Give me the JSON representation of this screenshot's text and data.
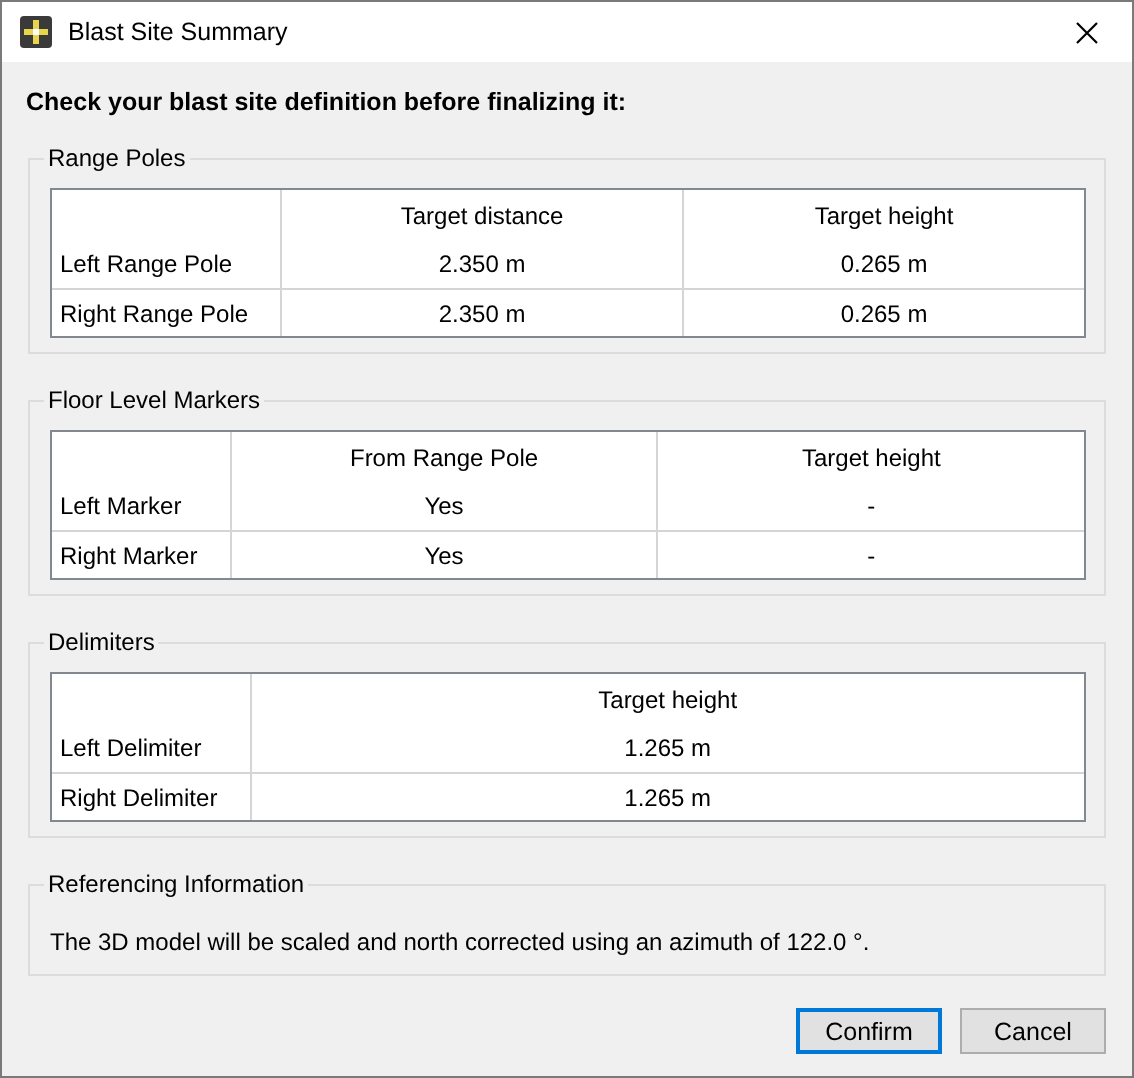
{
  "window": {
    "title": "Blast Site Summary"
  },
  "instruction": "Check your blast site definition before finalizing it:",
  "groups": [
    {
      "title": "Range Poles",
      "kind": "table",
      "columns": [
        "Target distance",
        "Target height"
      ],
      "rows": [
        {
          "label": "Left Range Pole",
          "cells": [
            "2.350 m",
            "0.265 m"
          ]
        },
        {
          "label": "Right Range Pole",
          "cells": [
            "2.350 m",
            "0.265 m"
          ]
        }
      ]
    },
    {
      "title": "Floor Level Markers",
      "kind": "table",
      "columns": [
        "From Range Pole",
        "Target height"
      ],
      "rows": [
        {
          "label": "Left Marker",
          "cells": [
            "Yes",
            "-"
          ]
        },
        {
          "label": "Right Marker",
          "cells": [
            "Yes",
            "-"
          ]
        }
      ]
    },
    {
      "title": "Delimiters",
      "kind": "table",
      "columns": [
        "Target height"
      ],
      "rows": [
        {
          "label": "Left Delimiter",
          "cells": [
            "1.265 m"
          ]
        },
        {
          "label": "Right Delimiter",
          "cells": [
            "1.265 m"
          ]
        }
      ]
    },
    {
      "title": "Referencing Information",
      "kind": "text",
      "text": "The 3D model will be scaled and north corrected using an azimuth of 122.0 °."
    }
  ],
  "buttons": [
    {
      "label": "Confirm",
      "default": true
    },
    {
      "label": "Cancel",
      "default": false
    }
  ]
}
